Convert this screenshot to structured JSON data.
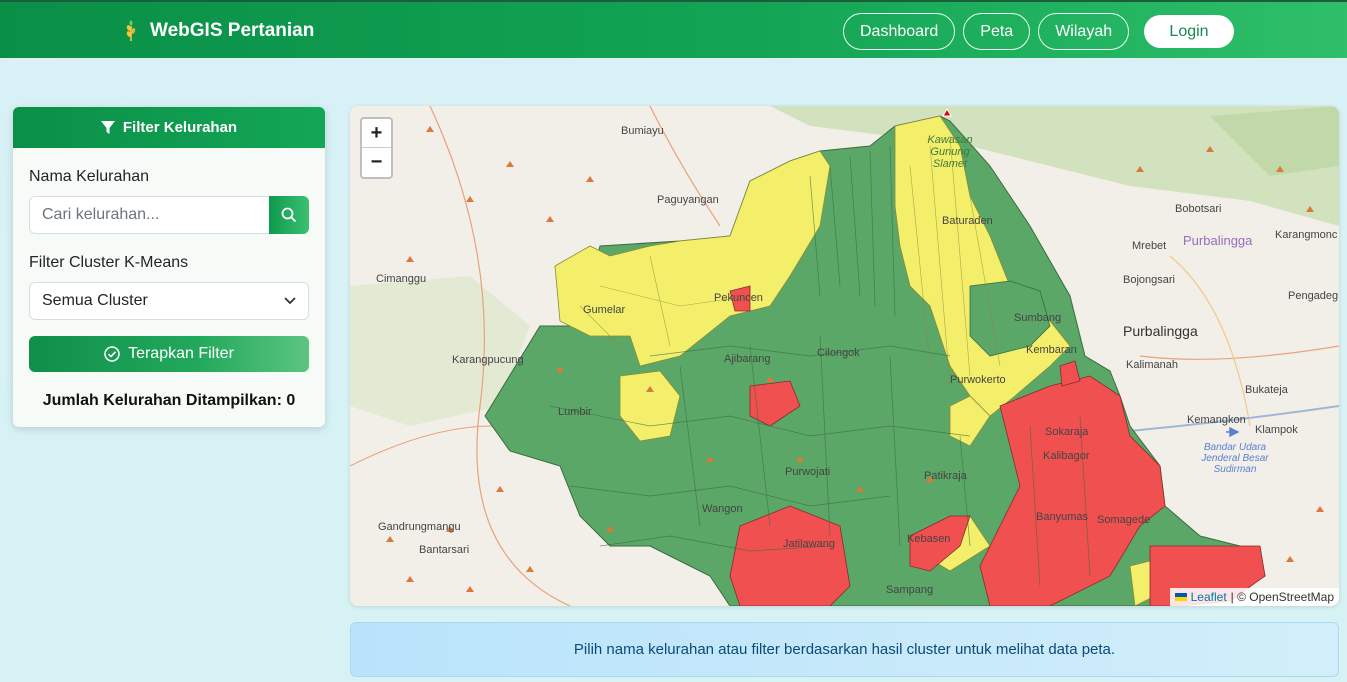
{
  "brand": {
    "title": "WebGIS Pertanian"
  },
  "nav": {
    "items": [
      {
        "label": "Dashboard"
      },
      {
        "label": "Peta"
      },
      {
        "label": "Wilayah"
      }
    ],
    "login_label": "Login"
  },
  "filter": {
    "header": "Filter Kelurahan",
    "name_label": "Nama Kelurahan",
    "search_placeholder": "Cari kelurahan...",
    "cluster_label": "Filter Cluster K-Means",
    "cluster_selected": "Semua Cluster",
    "apply_label": "Terapkan Filter",
    "count_text": "Jumlah Kelurahan Ditampilkan: 0"
  },
  "map": {
    "zoom_in": "+",
    "zoom_out": "−",
    "attribution_leaflet": "Leaflet",
    "attribution_rest": "| © OpenStreetMap",
    "colors": {
      "green": "#3a9a4a",
      "yellow": "#f2ee6a",
      "red": "#f44a4a"
    },
    "places": [
      "Bumiayu",
      "Paguyangan",
      "Cimanggu",
      "Karangpucung",
      "Gandrungmangu",
      "Bantarsari",
      "Bobotsari",
      "Mrebet",
      "Purbalingga",
      "Karangmonc",
      "Bojongsari",
      "Pengadeg",
      "Purbalingga",
      "Kalimanah",
      "Bukateja",
      "Kemangkon",
      "Klampok",
      "Kawasan Gunung Slamet",
      "Baturaden",
      "Sumbang",
      "Kembaran",
      "Purwokerto",
      "Pekuncen",
      "Gumelar",
      "Ajibarang",
      "Cilongok",
      "Lumbir",
      "Purwojati",
      "Wangon",
      "Patikraja",
      "Jatilawang",
      "Kebasen",
      "Sokaraja",
      "Kalibagor",
      "Banyumas",
      "Somagede",
      "Sampang",
      "Bandar Udara Jenderal Besar Sudirman"
    ]
  },
  "info_message": "Pilih nama kelurahan atau filter berdasarkan hasil cluster untuk melihat data peta."
}
